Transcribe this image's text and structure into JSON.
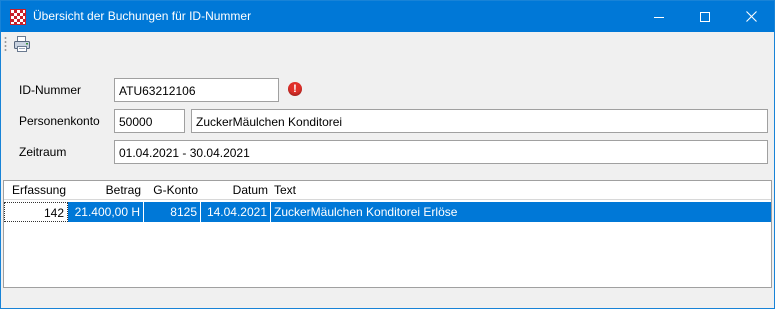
{
  "window": {
    "title": "Übersicht der Buchungen für ID-Nummer"
  },
  "toolbar": {
    "print_icon": "printer-icon"
  },
  "form": {
    "id_label": "ID-Nummer",
    "id_value": "ATU63212106",
    "id_warning_icon": "error-icon",
    "id_warning_glyph": "!",
    "account_label": "Personenkonto",
    "account_number": "50000",
    "account_name": "ZuckerMäulchen Konditorei",
    "period_label": "Zeitraum",
    "period_value": "01.04.2021 - 30.04.2021"
  },
  "table": {
    "columns": [
      "Erfassung",
      "Betrag",
      "G-Konto",
      "Datum",
      "Text"
    ],
    "rows": [
      {
        "erfassung": "142",
        "betrag": "21.400,00 H",
        "gkonto": "8125",
        "datum": "14.04.2021",
        "text": "ZuckerMäulchen Konditorei Erlöse"
      }
    ]
  },
  "colors": {
    "titlebar": "#0078d7",
    "selection": "#0078d7",
    "warning": "#e0302a"
  }
}
